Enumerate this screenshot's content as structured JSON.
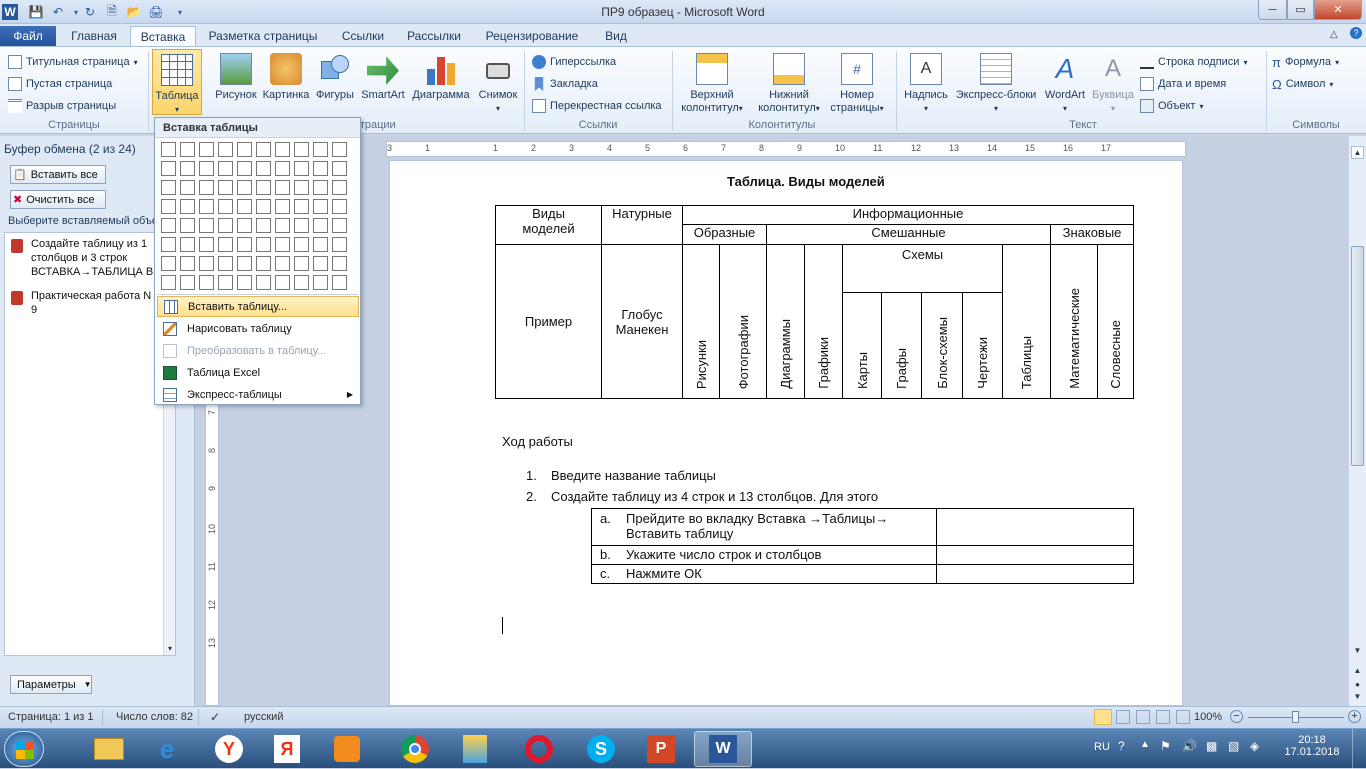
{
  "window": {
    "title": "ПР9 образец  -  Microsoft Word"
  },
  "tabs": [
    "Файл",
    "Главная",
    "Вставка",
    "Разметка страницы",
    "Ссылки",
    "Рассылки",
    "Рецензирование",
    "Вид"
  ],
  "ribbon": {
    "pages": {
      "items": [
        "Титульная страница",
        "Пустая страница",
        "Разрыв страницы"
      ],
      "label": "Страницы"
    },
    "table": {
      "label": "Таблица"
    },
    "illustrations": {
      "items": [
        "Рисунок",
        "Картинка",
        "Фигуры",
        "SmartArt",
        "Диаграмма",
        "Снимок"
      ],
      "label": "страции"
    },
    "links": {
      "items": [
        "Гиперссылка",
        "Закладка",
        "Перекрестная ссылка"
      ],
      "label": "Ссылки"
    },
    "headers": {
      "items": [
        [
          "Верхний",
          "колонтитул"
        ],
        [
          "Нижний",
          "колонтитул"
        ],
        [
          "Номер",
          "страницы"
        ]
      ],
      "label": "Колонтитулы"
    },
    "text": {
      "items": [
        "Надпись",
        "Экспресс-блоки",
        "WordArt",
        "Буквица"
      ],
      "small": [
        "Строка подписи",
        "Дата и время",
        "Объект"
      ],
      "label": "Текст"
    },
    "symbols": {
      "items": [
        "Формула",
        "Символ"
      ],
      "label": "Символы"
    }
  },
  "dropdown": {
    "header": "Вставка таблицы",
    "items": [
      "Вставить таблицу...",
      "Нарисовать таблицу",
      "Преобразовать в таблицу...",
      "Таблица Excel",
      "Экспресс-таблицы"
    ]
  },
  "clipboard": {
    "title": "Буфер обмена (2 из 24)",
    "paste_all": "Вставить все",
    "clear_all": "Очистить все",
    "hint": "Выберите вставляемый объе",
    "items": [
      [
        "Создайте таблицу из 1",
        "столбцов и 3 строк",
        "ВСТАВКА→ТАБЛИЦА В..."
      ],
      [
        "Практическая работа N",
        "9"
      ]
    ],
    "params": "Параметры"
  },
  "document": {
    "title": "Таблица. Виды моделей",
    "t1": {
      "vidy": [
        "Виды",
        "моделей"
      ],
      "naturnye": "Натурные",
      "informacionnye": "Информационные",
      "obraznye": "Образные",
      "smeshannye": "Смешанные",
      "znakovye": "Знаковые",
      "schemy": "Схемы",
      "primer": "Пример",
      "globus": [
        "Глобус",
        "Манекен"
      ],
      "vertical": [
        "Рисунки",
        "Фотографии",
        "Диаграммы",
        "Графики",
        "Карты",
        "Графы",
        "Блок-схемы",
        "Чертежи",
        "Таблицы",
        "Математические",
        "Словесные"
      ]
    },
    "hod": "Ход работы",
    "list": [
      "Введите название таблицы",
      "Создайте таблицу  из 4 строк и  13 столбцов. Для этого"
    ],
    "list_nums": [
      "1.",
      "2."
    ],
    "t2": [
      {
        "n": "a.",
        "text": [
          "Прейдите во вкладку Вставка →Таблицы→",
          "Вставить таблицу"
        ]
      },
      {
        "n": "b.",
        "text": [
          "Укажите число строк и столбцов"
        ]
      },
      {
        "n": "c.",
        "text": [
          "Нажмите ОК"
        ]
      }
    ]
  },
  "status": {
    "page": "Страница: 1 из 1",
    "words": "Число слов: 82",
    "lang": "русский",
    "zoom": "100%"
  },
  "tray": {
    "lang": "RU",
    "time": "20:18",
    "date": "17.01.2018"
  }
}
